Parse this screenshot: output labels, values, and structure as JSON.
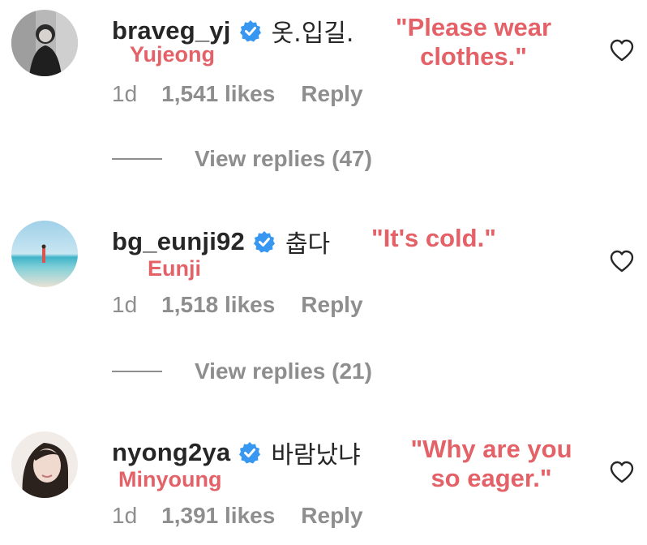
{
  "comments": [
    {
      "username": "braveg_yj",
      "text": "옷.입길.",
      "translation_line1": "\"Please wear",
      "translation_line2": "clothes.\"",
      "realname": "Yujeong",
      "time": "1d",
      "likes": "1,541 likes",
      "reply_label": "Reply",
      "view_replies": "View replies (47)"
    },
    {
      "username": "bg_eunji92",
      "text": "춥다",
      "translation_line1": "\"It's cold.\"",
      "realname": "Eunji",
      "time": "1d",
      "likes": "1,518 likes",
      "reply_label": "Reply",
      "view_replies": "View replies (21)"
    },
    {
      "username": "nyong2ya",
      "text": "바람났냐",
      "translation_line1": "\"Why are you",
      "translation_line2": "so eager.\"",
      "realname": "Minyoung",
      "time": "1d",
      "likes": "1,391 likes",
      "reply_label": "Reply"
    }
  ],
  "colors": {
    "translation": "#e46168",
    "verified": "#3897f0",
    "secondary_text": "#8e8e8e",
    "primary_text": "#262626"
  },
  "icons": {
    "verified": "verified-badge-icon",
    "like": "heart-outline-icon"
  }
}
